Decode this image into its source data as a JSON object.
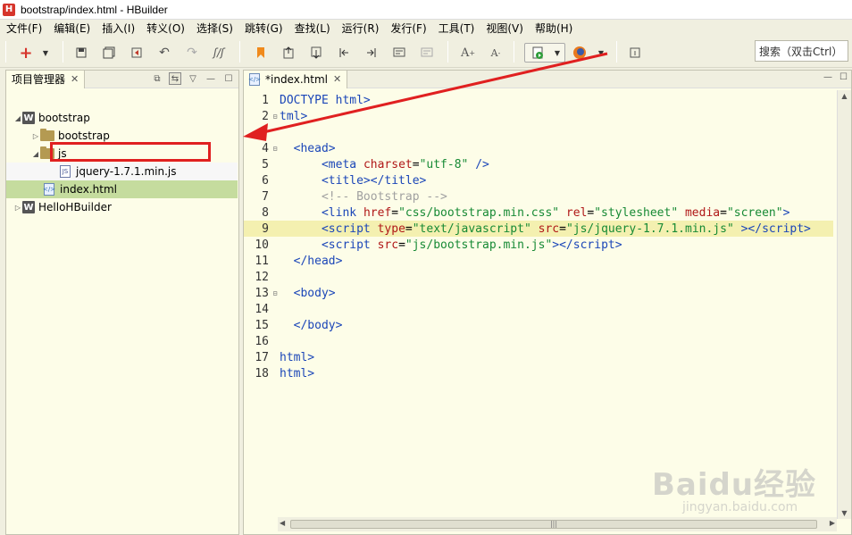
{
  "window": {
    "title": "bootstrap/index.html  -  HBuilder",
    "logo": "H"
  },
  "menu": [
    "文件(F)",
    "编辑(E)",
    "插入(I)",
    "转义(O)",
    "选择(S)",
    "跳转(G)",
    "查找(L)",
    "运行(R)",
    "发行(F)",
    "工具(T)",
    "视图(V)",
    "帮助(H)"
  ],
  "toolbar": {
    "search_placeholder": "搜索（双击Ctrl）"
  },
  "project_panel": {
    "title": "项目管理器",
    "tree": [
      {
        "label": "bootstrap",
        "type": "project",
        "depth": 0,
        "expanded": true
      },
      {
        "label": "bootstrap",
        "type": "folder",
        "depth": 1,
        "expanded": false
      },
      {
        "label": "js",
        "type": "folder",
        "depth": 1,
        "expanded": true
      },
      {
        "label": "jquery-1.7.1.min.js",
        "type": "js",
        "depth": 2
      },
      {
        "label": "index.html",
        "type": "html",
        "depth": 1
      },
      {
        "label": "HelloHBuilder",
        "type": "project",
        "depth": 0,
        "expanded": false
      }
    ]
  },
  "editor": {
    "tab_label": "*index.html",
    "current_line": 9,
    "lines": [
      "1",
      "2",
      "4",
      "5",
      "6",
      "7",
      "8",
      "9",
      "10",
      "11",
      "12",
      "13",
      "14",
      "15",
      "16",
      "17",
      "18"
    ]
  },
  "watermark": {
    "brand": "Baidu经验",
    "sub": "jingyan.baidu.com"
  },
  "colors": {
    "panel_bg": "#fdfde8",
    "selection": "#c5dc9e",
    "current_line": "#f4f0b0",
    "annotation": "#e02020"
  }
}
